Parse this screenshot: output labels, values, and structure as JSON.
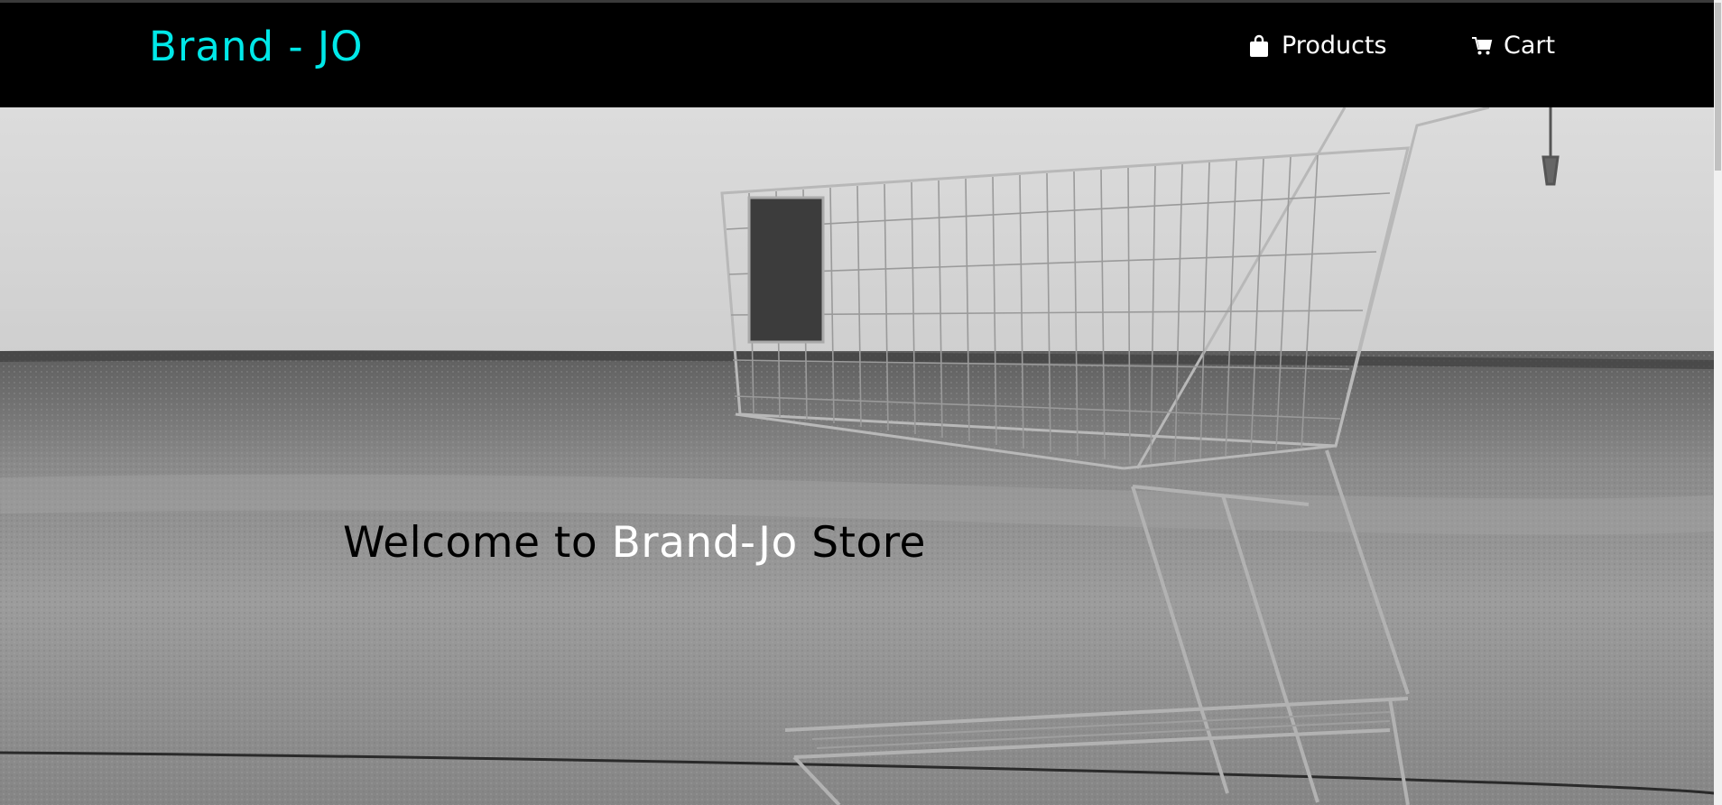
{
  "navbar": {
    "brand": "Brand - JO",
    "links": [
      {
        "label": "Products",
        "icon": "shopping-bag-icon"
      },
      {
        "label": "Cart",
        "icon": "shopping-cart-icon"
      }
    ]
  },
  "hero": {
    "title_prefix": "Welcome to ",
    "title_accent": "Brand-Jo",
    "title_suffix": " Store",
    "image": "shopping-cart-in-field-photo"
  },
  "colors": {
    "navbar_bg": "#000000",
    "brand": "#00e8e8",
    "nav_text": "#ffffff",
    "accent_text": "#ffffff"
  }
}
